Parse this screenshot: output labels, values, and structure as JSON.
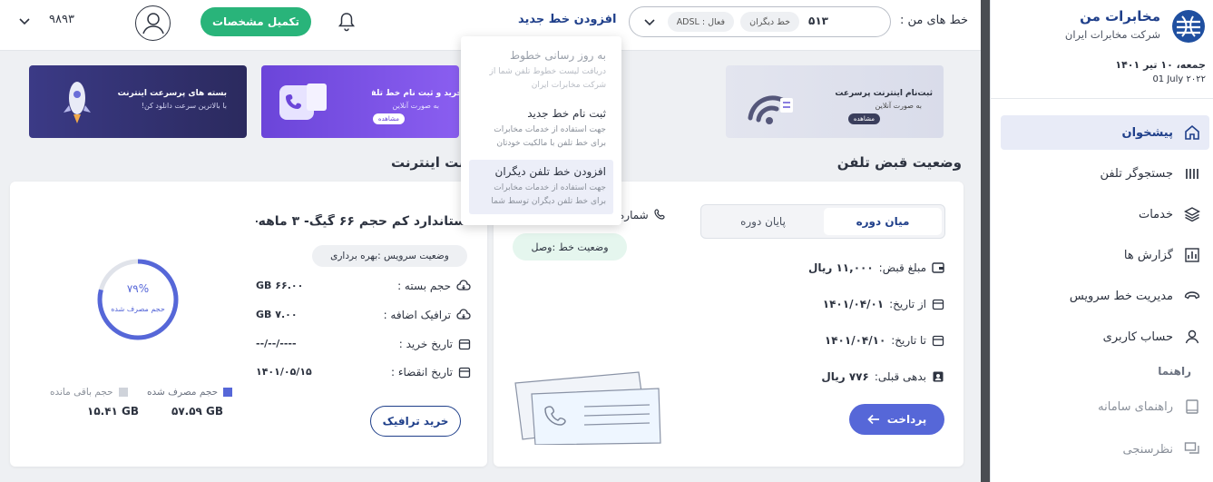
{
  "sidebar": {
    "brand_title": "مخابرات من",
    "brand_subtitle": "شرکت مخابرات ایران",
    "date_fa": "جمعه، ۱۰ تیر ۱۴۰۱",
    "date_en": "01 July ۲۰۲۲",
    "items": [
      {
        "label": "پیشخوان",
        "icon": "home-icon"
      },
      {
        "label": "جستجوگر تلفن",
        "icon": "phone-search-icon"
      },
      {
        "label": "خدمات",
        "icon": "layers-icon"
      },
      {
        "label": "گزارش ها",
        "icon": "chart-icon"
      },
      {
        "label": "مدیریت خط سرویس",
        "icon": "phone-manage-icon"
      },
      {
        "label": "حساب کاربری",
        "icon": "user-icon"
      }
    ],
    "guide_heading": "راهنما",
    "guide_items": [
      {
        "label": "راهنمای سامانه",
        "icon": "book-icon"
      },
      {
        "label": "نظرسنجی",
        "icon": "survey-icon"
      }
    ]
  },
  "topbar": {
    "my_lines_label": "خط های من :",
    "line_number": "۵۱۳",
    "badge_other": "خط دیگران",
    "badge_adsl": "ADSL : فعال",
    "add_line": "افزودن خط جدید",
    "complete_profile": "تکمیل مشخصات",
    "user_number": "۹۸۹۳"
  },
  "dropdown": [
    {
      "title": "به روز رسانی خطوط",
      "desc": "دریافت لیست خطوط تلفن شما از شرکت مخابرات ایران"
    },
    {
      "title": "ثبت نام خط جدید",
      "desc": "جهت استفاده از خدمات مخابرات برای خط تلفن با مالکیت خودتان"
    },
    {
      "title": "افزودن خط تلفن دیگران",
      "desc": "جهت استفاده از خدمات مخابرات برای خط تلفن دیگران توسط شما"
    }
  ],
  "banners": [
    {
      "title": "ثبت‌نام اینترنت پرسرعت",
      "sub": "به صورت آنلاین",
      "btn": "مشاهده"
    },
    {
      "title": "خرید و ثبت نام خط تلفن",
      "sub": "به صورت آنلاین",
      "btn": "مشاهده"
    },
    {
      "title": "بسته های پرسرعت اینترنت",
      "sub": "با بالاترین سرعت دانلود کن!"
    }
  ],
  "bill": {
    "section_title": "وضعیت قبض تلفن",
    "tab_mid": "میان دوره",
    "tab_end": "پایان دوره",
    "amount_label": "مبلغ قبض:",
    "amount_value": "۱۱,۰۰۰ ریال",
    "from_label": "از تاریخ:",
    "from_value": "۱۴۰۱/۰۴/۰۱",
    "to_label": "تا تاریخ:",
    "to_value": "۱۴۰۱/۰۴/۱۰",
    "debt_label": "بدهی قبلی:",
    "debt_value": "۷۷۶ ریال",
    "pay_button": "پرداخت",
    "phone_label": "شماره",
    "line_status": "وضعیت خط :وصل"
  },
  "internet": {
    "section_title": "ثبت اینترنت",
    "package_title": "ستاندارد کم حجم ۶۶ گیگ- ۳ ماهه-",
    "service_status": "وضعیت سرویس :بهره برداری",
    "rows": [
      {
        "label": "حجم بسته :",
        "value": "۶۶.۰۰ GB",
        "icon": "cloud-icon"
      },
      {
        "label": "ترافیک اضافه :",
        "value": "۷.۰۰ GB",
        "icon": "cloud-icon"
      },
      {
        "label": "تاریخ خرید :",
        "value": "----/--/--",
        "icon": "calendar-icon"
      },
      {
        "label": "تاریخ انقضاء :",
        "value": "۱۴۰۱/۰۵/۱۵",
        "icon": "calendar-icon"
      }
    ],
    "gauge_percent": "۷۹%",
    "gauge_fraction": 0.79,
    "gauge_label": "حجم مصرف شده",
    "legend_used": "حجم مصرف شده",
    "legend_remaining": "حجم باقی مانده",
    "used_value": "۵۷.۵۹ GB",
    "remaining_value": "۱۵.۴۱ GB",
    "buy_button": "خرید ترافیک"
  },
  "colors": {
    "primary": "#5667d8",
    "green": "#29b47a",
    "navy": "#1f3f8a"
  }
}
